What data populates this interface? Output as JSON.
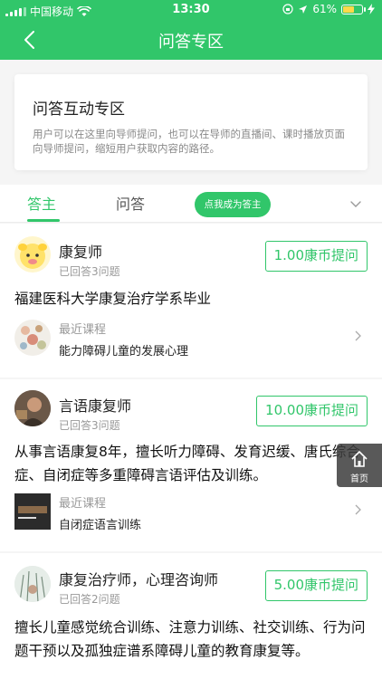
{
  "status_bar": {
    "carrier": "中国移动",
    "time": "13:30",
    "battery": "61%",
    "battery_level": 0.61
  },
  "header": {
    "title": "问答专区",
    "back_icon": "chevron-left-icon"
  },
  "intro": {
    "title": "问答互动专区",
    "description": "用户可以在这里向导师提问，也可以在导师的直播间、课时播放页面向导师提问，缩短用户获取内容的路径。"
  },
  "tabs": {
    "items": [
      {
        "label": "答主",
        "active": true
      },
      {
        "label": "问答",
        "active": false
      }
    ],
    "become_button": "点我成为答主",
    "dropdown_icon": "chevron-down-icon"
  },
  "answerers": [
    {
      "name": "康复师",
      "answered": "已回答3问题",
      "price": "1.00康币提问",
      "bio": "福建医科大学康复治疗学系毕业",
      "course_label": "最近课程",
      "course_name": "能力障碍儿童的发展心理"
    },
    {
      "name": "言语康复师",
      "answered": "已回答3问题",
      "price": "10.00康币提问",
      "bio": "从事言语康复8年，擅长听力障碍、发育迟缓、唐氏综合症、自闭症等多重障碍言语评估及训练。",
      "course_label": "最近课程",
      "course_name": "自闭症语言训练"
    },
    {
      "name": "康复治疗师，心理咨询师",
      "answered": "已回答2问题",
      "price": "5.00康币提问",
      "bio": "擅长儿童感觉统合训练、注意力训练、社交训练、行为问题干预以及孤独症谱系障碍儿童的教育康复等。"
    }
  ],
  "float_home": {
    "label": "首页",
    "icon": "home-icon"
  },
  "colors": {
    "accent": "#31c66a"
  }
}
